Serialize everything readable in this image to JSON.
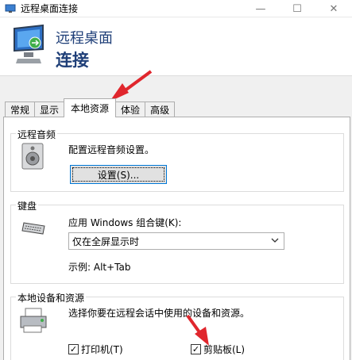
{
  "window": {
    "title": "远程桌面连接",
    "minimize": "—",
    "maximize": "☐",
    "close": "✕"
  },
  "header": {
    "line1": "远程桌面",
    "line2": "连接"
  },
  "tabs": [
    {
      "label": "常规"
    },
    {
      "label": "显示"
    },
    {
      "label": "本地资源",
      "active": true
    },
    {
      "label": "体验"
    },
    {
      "label": "高级"
    }
  ],
  "audio": {
    "legend": "远程音频",
    "desc": "配置远程音频设置。",
    "button": "设置(S)..."
  },
  "keyboard": {
    "legend": "键盘",
    "label": "应用 Windows 组合键(K):",
    "selected": "仅在全屏显示时",
    "example": "示例: Alt+Tab"
  },
  "devices": {
    "legend": "本地设备和资源",
    "desc": "选择你要在远程会话中使用的设备和资源。",
    "printer": "打印机(T)",
    "printer_checked": true,
    "clipboard": "剪贴板(L)",
    "clipboard_checked": true
  },
  "colors": {
    "accent": "#1f3f78",
    "arrow": "#e0262d"
  }
}
